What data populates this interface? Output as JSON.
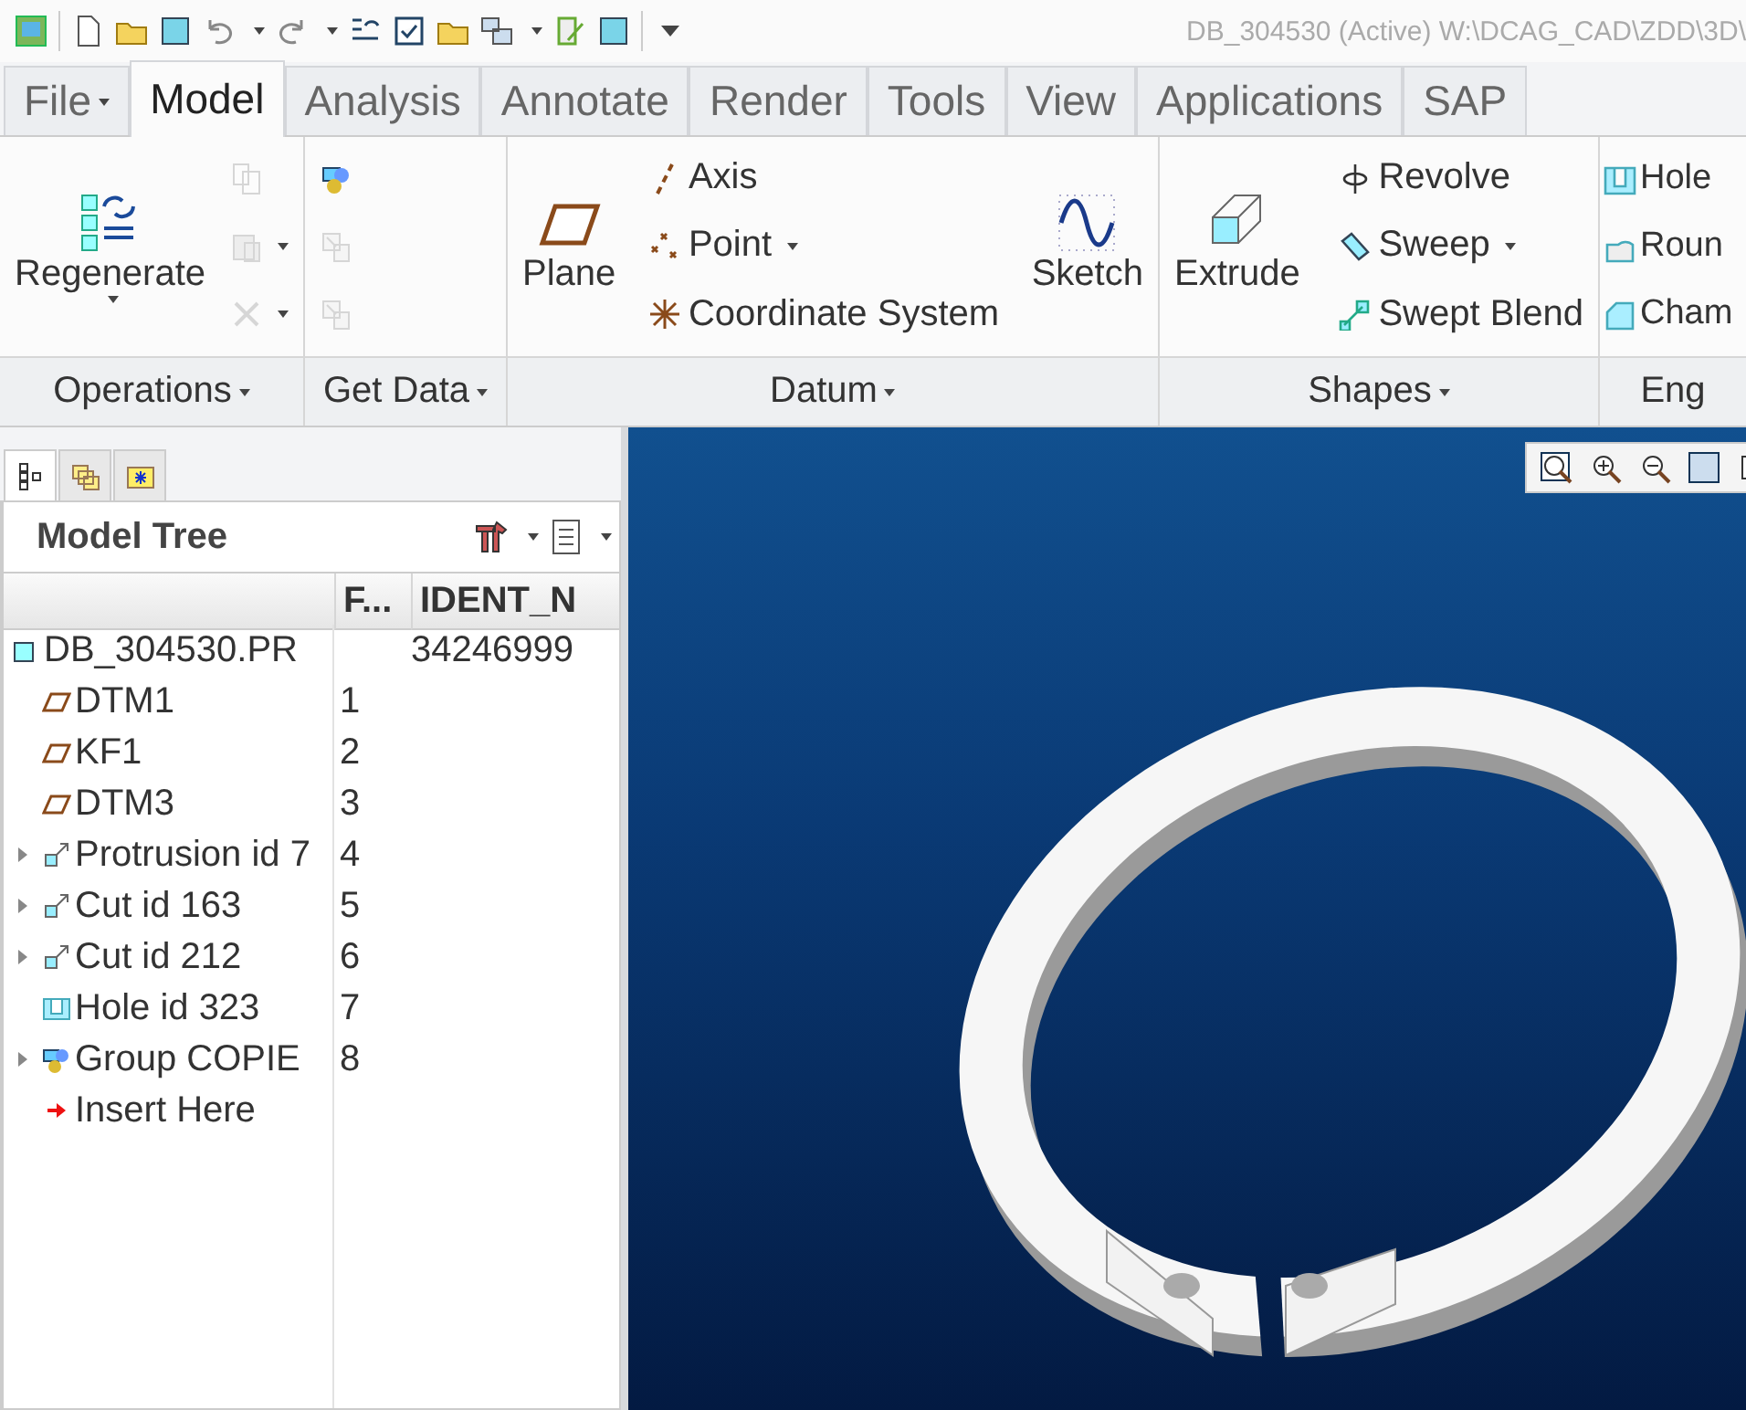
{
  "title_bar": {
    "title": "DB_304530 (Active) W:\\DCAG_CAD\\ZDD\\3D\\"
  },
  "ribbon_tabs": [
    {
      "label": "File",
      "selected": false,
      "dropdown": true
    },
    {
      "label": "Model",
      "selected": true,
      "dropdown": false
    },
    {
      "label": "Analysis",
      "selected": false,
      "dropdown": false
    },
    {
      "label": "Annotate",
      "selected": false,
      "dropdown": false
    },
    {
      "label": "Render",
      "selected": false,
      "dropdown": false
    },
    {
      "label": "Tools",
      "selected": false,
      "dropdown": false
    },
    {
      "label": "View",
      "selected": false,
      "dropdown": false
    },
    {
      "label": "Applications",
      "selected": false,
      "dropdown": false
    },
    {
      "label": "SAP",
      "selected": false,
      "dropdown": false
    }
  ],
  "ribbon_groups": [
    {
      "label": "Operations",
      "dropdown": true,
      "columns": [
        [
          {
            "kind": "large",
            "label": "Regenerate",
            "dropdown": true
          }
        ],
        [
          {
            "kind": "icon",
            "dropdown": false,
            "disabled": true
          },
          {
            "kind": "icon",
            "dropdown": true,
            "disabled": true
          },
          {
            "kind": "icon",
            "dropdown": true,
            "disabled": true
          }
        ]
      ]
    },
    {
      "label": "Get Data",
      "dropdown": true,
      "columns": [
        [
          {
            "kind": "icon",
            "dropdown": false,
            "disabled": false
          },
          {
            "kind": "icon",
            "dropdown": false,
            "disabled": true
          },
          {
            "kind": "icon",
            "dropdown": false,
            "disabled": true
          }
        ]
      ]
    },
    {
      "label": "Datum",
      "dropdown": true,
      "columns": [
        [
          {
            "kind": "large",
            "label": "Plane",
            "dropdown": false
          }
        ],
        [
          {
            "kind": "small",
            "label": "Axis",
            "dropdown": false
          },
          {
            "kind": "small",
            "label": "Point",
            "dropdown": true
          },
          {
            "kind": "small",
            "label": "Coordinate System",
            "dropdown": false
          }
        ],
        [
          {
            "kind": "large",
            "label": "Sketch",
            "dropdown": false
          }
        ]
      ]
    },
    {
      "label": "Shapes",
      "dropdown": true,
      "columns": [
        [
          {
            "kind": "large",
            "label": "Extrude",
            "dropdown": false
          }
        ],
        [
          {
            "kind": "small",
            "label": "Revolve",
            "dropdown": false
          },
          {
            "kind": "small",
            "label": "Sweep",
            "dropdown": true
          },
          {
            "kind": "small",
            "label": "Swept Blend",
            "dropdown": false
          }
        ]
      ]
    },
    {
      "label": "Eng",
      "dropdown": false,
      "columns": [
        [
          {
            "kind": "small",
            "label": "Hole",
            "dropdown": false
          },
          {
            "kind": "small",
            "label": "Roun",
            "dropdown": false
          },
          {
            "kind": "small",
            "label": "Cham",
            "dropdown": false
          }
        ]
      ]
    }
  ],
  "navigator_tabs": [
    {
      "selected": true
    },
    {
      "selected": false
    },
    {
      "selected": false
    }
  ],
  "model_tree": {
    "title": "Model Tree",
    "columns": [
      "F...",
      "IDENT_N"
    ],
    "root": {
      "kind": "part",
      "name": "DB_304530.PR",
      "ident": "34246999",
      "expandable": false,
      "children": [
        {
          "kind": "datum",
          "name": "DTM1",
          "f": "1",
          "expandable": false
        },
        {
          "kind": "datum",
          "name": "KF1",
          "f": "2",
          "expandable": false
        },
        {
          "kind": "datum",
          "name": "DTM3",
          "f": "3",
          "expandable": false
        },
        {
          "kind": "feature",
          "name": "Protrusion id 7",
          "f": "4",
          "expandable": true
        },
        {
          "kind": "feature",
          "name": "Cut id 163",
          "f": "5",
          "expandable": true
        },
        {
          "kind": "feature",
          "name": "Cut id 212",
          "f": "6",
          "expandable": true
        },
        {
          "kind": "hole",
          "name": "Hole id 323",
          "f": "7",
          "expandable": false
        },
        {
          "kind": "group",
          "name": "Group COPIE",
          "f": "8",
          "expandable": true
        },
        {
          "kind": "insert",
          "name": "Insert Here",
          "expandable": false
        }
      ]
    }
  }
}
